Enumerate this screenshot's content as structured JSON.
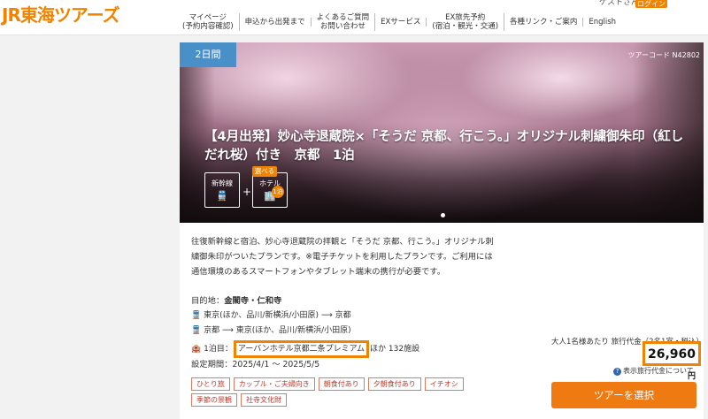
{
  "header": {
    "logo": "JR東海ツアーズ",
    "guest": "ゲストさん",
    "login": "ログイン",
    "nav": [
      {
        "line1": "マイページ",
        "line2": "(予約内容確認)"
      },
      {
        "line1": "申込から出発まで",
        "line2": ""
      },
      {
        "line1": "よくあるご質問",
        "line2": "お問い合わせ"
      },
      {
        "line1": "EXサービス",
        "line2": ""
      },
      {
        "line1": "EX旅先予約",
        "line2": "(宿泊・観光・交通)"
      },
      {
        "line1": "各種リンク・ご案内",
        "line2": ""
      },
      {
        "line1": "English",
        "line2": ""
      }
    ]
  },
  "hero": {
    "days_badge": "2日間",
    "tour_code": "ツアーコード N42802",
    "title": "【4月出発】妙心寺退蔵院×「そうだ 京都、行こう。」オリジナル刺繍御朱印（紅しだれ桜）付き　京都　1泊",
    "transport1": "新幹線",
    "transport2": "ホテル",
    "choice": "選べる",
    "nights": "1泊"
  },
  "tour": {
    "description": "往復新幹線と宿泊、妙心寺退蔵院の拝観と「そうだ 京都、行こう。」オリジナル刺繍御朱印がついたプランです。※電子チケットを利用したプランです。ご利用には通信環境のあるスマートフォンやタブレット端末の携行が必要です。",
    "dest_label": "目的地：",
    "dest_value": "金閣寺・仁和寺",
    "route_out": "東京(ほか、品川/新横浜/小田原) ⟶ 京都",
    "route_back": "京都 ⟶ 東京(ほか、品川/新横浜/小田原)",
    "hotel_prefix": "1泊目：",
    "hotel_name": "アーバンホテル京都二条プレミアム",
    "hotel_suffix": "ほか 132施設",
    "period": "設定期間：2025/4/1 〜 2025/5/5",
    "tags": [
      "ひとり旅",
      "カップル・ご夫婦向き",
      "朝食付あり",
      "夕朝食付あり",
      "イチオシ",
      "季節の景観",
      "社寺文化財"
    ]
  },
  "price": {
    "note": "大人1名様あたり 旅行代金（2名1室・税込）",
    "amount": "26,960",
    "yen": "円",
    "info": "表示旅行代金について",
    "select": "ツアーを選択"
  }
}
